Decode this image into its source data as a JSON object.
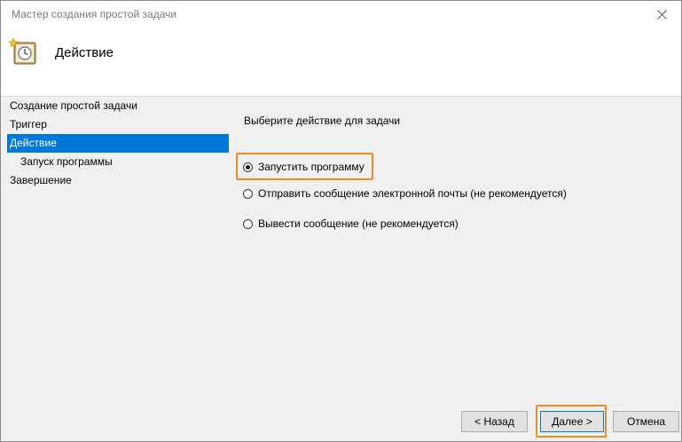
{
  "window": {
    "title": "Мастер создания простой задачи"
  },
  "header": {
    "title": "Действие"
  },
  "nav": {
    "items": [
      {
        "label": "Создание простой задачи"
      },
      {
        "label": "Триггер"
      },
      {
        "label": "Действие"
      },
      {
        "label": "Запуск программы"
      },
      {
        "label": "Завершение"
      }
    ]
  },
  "main": {
    "prompt": "Выберите действие для задачи",
    "options": [
      {
        "label": "Запустить программу",
        "selected": true
      },
      {
        "label": "Отправить сообщение электронной почты (не рекомендуется)",
        "selected": false
      },
      {
        "label": "Вывести сообщение (не рекомендуется)",
        "selected": false
      }
    ]
  },
  "buttons": {
    "back": "< Назад",
    "next": "Далее >",
    "cancel": "Отмена"
  },
  "colors": {
    "selection": "#0078d7",
    "highlight": "#f08c1e"
  }
}
